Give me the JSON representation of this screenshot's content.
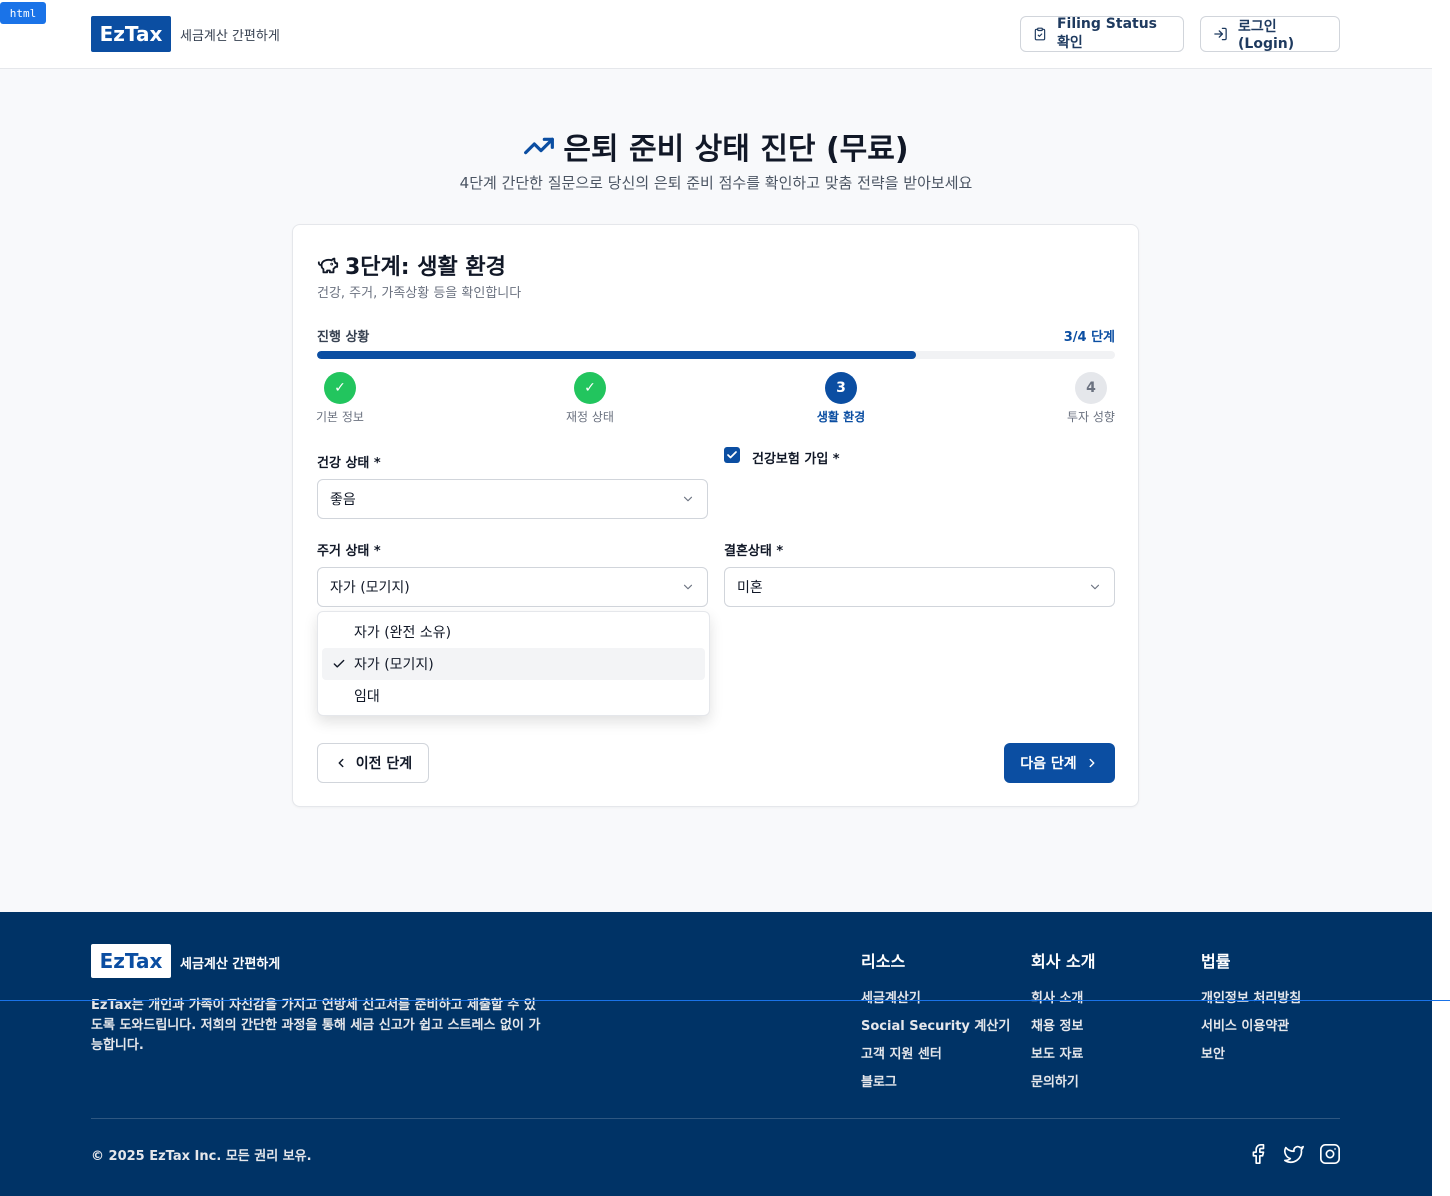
{
  "debug_tag": "html",
  "header": {
    "logo": "EzTax",
    "tagline": "세금계산 간편하게",
    "filing_status_label": "Filing Status 확인",
    "login_label": "로그인(Login)"
  },
  "hero": {
    "title": "은퇴 준비 상태 진단 (무료)",
    "subtitle": "4단계 간단한 질문으로 당신의 은퇴 준비 점수를 확인하고 맞춤 전략을 받아보세요"
  },
  "card": {
    "step_title": "3단계: 생활 환경",
    "step_desc": "건강, 주거, 가족상황 등을 확인합니다",
    "progress_label": "진행 상황",
    "progress_count": "3/4 단계",
    "progress_fraction": 0.75,
    "steps": [
      {
        "label": "기본 정보",
        "state": "done",
        "mark": "✓"
      },
      {
        "label": "재정 상태",
        "state": "done",
        "mark": "✓"
      },
      {
        "label": "생활 환경",
        "state": "current",
        "mark": "3"
      },
      {
        "label": "투자 성향",
        "state": "todo",
        "mark": "4"
      }
    ],
    "health_label": "건강 상태 *",
    "health_value": "좋음",
    "insurance_label": "건강보험 가입 *",
    "insurance_checked": true,
    "housing_label": "주거 상태 *",
    "housing_value": "자가 (모기지)",
    "marital_label": "결혼상태 *",
    "marital_value": "미혼",
    "housing_options": [
      "자가 (완전 소유)",
      "자가 (모기지)",
      "임대"
    ],
    "housing_selected_index": 1,
    "prev_label": "이전 단계",
    "next_label": "다음 단계"
  },
  "footer": {
    "logo": "EzTax",
    "tagline": "세금계산 간편하게",
    "description": "EzTax는 개인과 가족이 자신감을 가지고 연방세 신고서를 준비하고 제출할 수 있도록 도와드립니다. 저희의 간단한 과정을 통해 세금 신고가 쉽고 스트레스 없이 가능합니다.",
    "columns": [
      {
        "title": "리소스",
        "links": [
          "세금계산기",
          "Social Security 계산기",
          "고객 지원 센터",
          "블로그"
        ]
      },
      {
        "title": "회사 소개",
        "links": [
          "회사 소개",
          "채용 정보",
          "보도 자료",
          "문의하기"
        ]
      },
      {
        "title": "법률",
        "links": [
          "개인정보 처리방침",
          "서비스 이용약관",
          "보안"
        ]
      }
    ],
    "copyright": "© 2025 EzTax Inc. 모든 권리 보유.",
    "social_icons": [
      "facebook-icon",
      "twitter-icon",
      "instagram-icon"
    ]
  },
  "colors": {
    "brand": "#0b4ea2",
    "footer_bg": "#003366",
    "success": "#22c55e"
  }
}
